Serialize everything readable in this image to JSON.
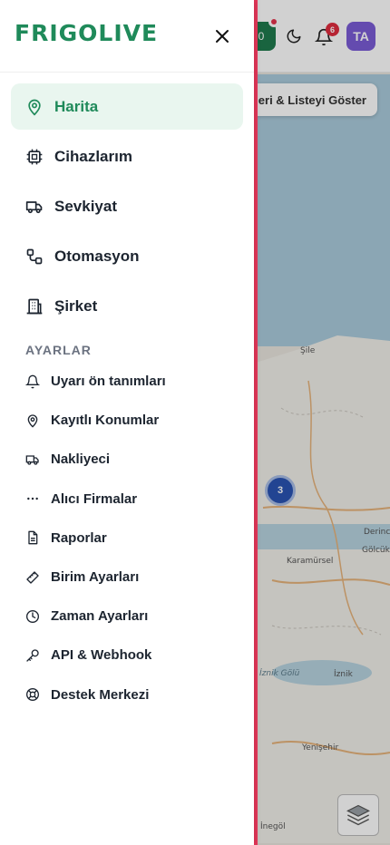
{
  "brand": {
    "logo_text": "FRIGOLIVE",
    "color": "#1f8a5a"
  },
  "header": {
    "notification_count": "6",
    "avatar_initials": "TA",
    "green_badge_text": "0"
  },
  "map": {
    "show_button_label": "eri & Listeyi Göster",
    "cluster_count": "3",
    "towns": [
      "Şile",
      "Derinc",
      "Gölcük",
      "Karamürsel",
      "İznik Gölü",
      "İznik",
      "Yenişehir",
      "İnegöl"
    ]
  },
  "sidebar": {
    "primary": [
      {
        "label": "Harita",
        "icon": "map-pin-icon",
        "active": true
      },
      {
        "label": "Cihazlarım",
        "icon": "chip-icon",
        "active": false
      },
      {
        "label": "Sevkiyat",
        "icon": "truck-icon",
        "active": false
      },
      {
        "label": "Otomasyon",
        "icon": "workflow-icon",
        "active": false
      },
      {
        "label": "Şirket",
        "icon": "building-icon",
        "active": false
      }
    ],
    "section_title": "AYARLAR",
    "settings": [
      {
        "label": "Uyarı ön tanımları",
        "icon": "bell-icon"
      },
      {
        "label": "Kayıtlı Konumlar",
        "icon": "map-pin-icon"
      },
      {
        "label": "Nakliyeci",
        "icon": "truck-icon"
      },
      {
        "label": "Alıcı Firmalar",
        "icon": "ellipsis-icon"
      },
      {
        "label": "Raporlar",
        "icon": "document-icon"
      },
      {
        "label": "Birim Ayarları",
        "icon": "ruler-icon"
      },
      {
        "label": "Zaman Ayarları",
        "icon": "clock-icon"
      },
      {
        "label": "API & Webhook",
        "icon": "key-icon"
      },
      {
        "label": "Destek Merkezi",
        "icon": "lifebuoy-icon"
      }
    ]
  }
}
